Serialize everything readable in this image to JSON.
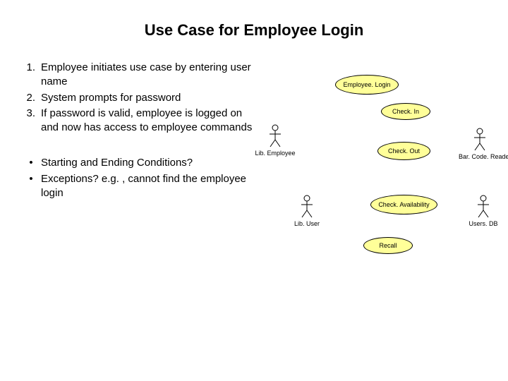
{
  "title": "Use Case for Employee Login",
  "steps": [
    {
      "num": "1.",
      "text": "Employee initiates use case by entering user name"
    },
    {
      "num": "2.",
      "text": "System prompts for password"
    },
    {
      "num": "3.",
      "text": "If password is valid, employee is logged on and now has access to employee commands"
    }
  ],
  "bullets": [
    {
      "mark": "•",
      "text": "Starting and Ending Conditions?"
    },
    {
      "mark": "•",
      "text": "Exceptions? e.g. , cannot find the employee login"
    }
  ],
  "actors": {
    "libEmployee": "Lib. Employee",
    "libUser": "Lib. User",
    "barcodeReader": "Bar. Code. Reader",
    "usersDb": "Users. DB"
  },
  "usecases": {
    "employeeLogin": "Employee. Login",
    "checkIn": "Check. In",
    "checkOut": "Check. Out",
    "checkAvailability": "Check. Availability",
    "recall": "Recall"
  }
}
